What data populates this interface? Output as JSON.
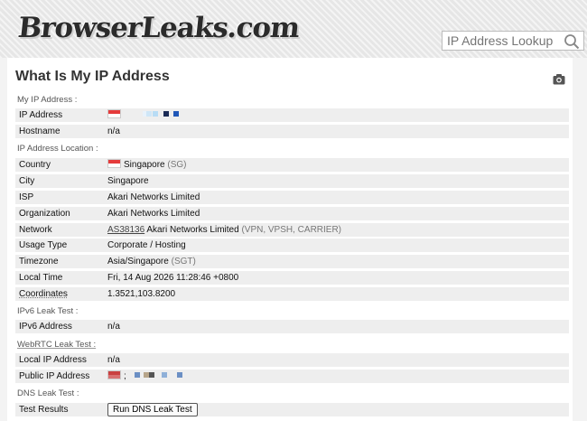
{
  "header": {
    "logo_text": "BrowserLeaks.com",
    "search_placeholder": "IP Address Lookup"
  },
  "page_title": "What Is My IP Address",
  "sections": {
    "my_ip": "My IP Address :",
    "location": "IP Address Location :",
    "ipv6": "IPv6 Leak Test :",
    "webrtc": "WebRTC Leak Test :",
    "dns": "DNS Leak Test :"
  },
  "rows": {
    "ip_address": {
      "label": "IP Address"
    },
    "hostname": {
      "label": "Hostname",
      "value": "n/a"
    },
    "country": {
      "label": "Country",
      "value": "Singapore",
      "code": "(SG)"
    },
    "city": {
      "label": "City",
      "value": "Singapore"
    },
    "isp": {
      "label": "ISP",
      "value": "Akari Networks Limited"
    },
    "organization": {
      "label": "Organization",
      "value": "Akari Networks Limited"
    },
    "network": {
      "label": "Network",
      "asn": "AS38136",
      "value": "Akari Networks Limited",
      "tags": "(VPN, VPSH, CARRIER)"
    },
    "usage_type": {
      "label": "Usage Type",
      "value": "Corporate / Hosting"
    },
    "timezone": {
      "label": "Timezone",
      "value": "Asia/Singapore",
      "code": "(SGT)"
    },
    "local_time": {
      "label": "Local Time",
      "value": "Fri, 14 Aug 2026 11:28:46 +0800"
    },
    "coordinates": {
      "label": "Coordinates",
      "value": "1.3521,103.8200"
    },
    "ipv6_address": {
      "label": "IPv6 Address",
      "value": "n/a"
    },
    "local_ip": {
      "label": "Local IP Address",
      "value": "n/a"
    },
    "public_ip": {
      "label": "Public IP Address",
      "separator": ";"
    },
    "test_results": {
      "label": "Test Results",
      "button": "Run DNS Leak Test"
    }
  },
  "icons": {
    "search": "search-icon",
    "camera": "camera-icon",
    "flag": "flag-sg-icon"
  },
  "colors": {
    "row_bg": "#eeeeee",
    "header_bg": "#e6e6e6",
    "flag_red": "#e53b3b"
  }
}
